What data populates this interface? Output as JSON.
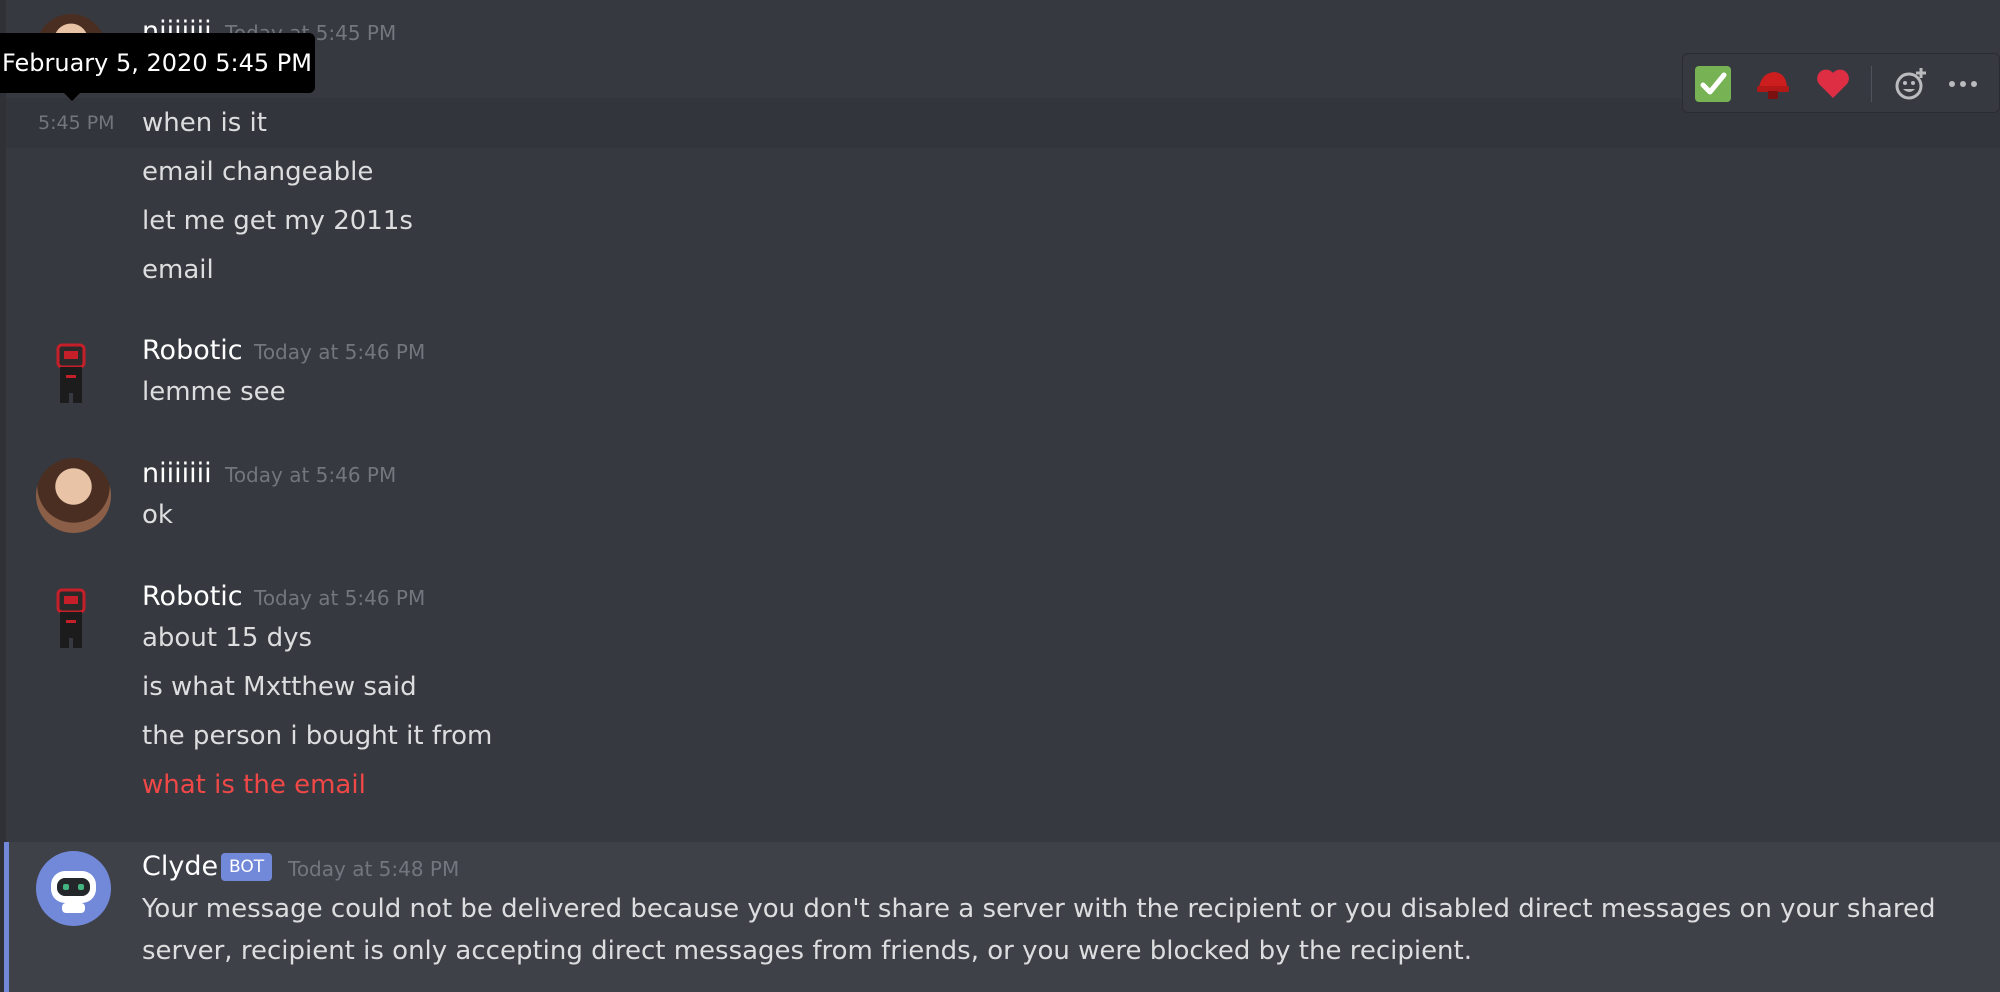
{
  "tooltip": {
    "text": "February 5, 2020 5:45 PM"
  },
  "hover_timestamp": "5:45 PM",
  "message_toolbar": {
    "reactions": [
      "check-mark-emoji",
      "red-hat-emoji",
      "red-heart-emoji"
    ],
    "add_reaction_icon": "add-reaction-icon",
    "more_icon": "more-options-icon"
  },
  "groups": [
    {
      "author": "niiiiiii",
      "timestamp": "Today at 5:45 PM",
      "messages": [
        "when is it",
        "email changeable",
        "let me get my 2011s",
        "email"
      ]
    },
    {
      "author": "Robotic",
      "timestamp": "Today at 5:46 PM",
      "messages": [
        "lemme see"
      ]
    },
    {
      "author": "niiiiiii",
      "timestamp": "Today at 5:46 PM",
      "messages": [
        "ok"
      ]
    },
    {
      "author": "Robotic",
      "timestamp": "Today at 5:46 PM",
      "messages": [
        "about 15 dys",
        "is what Mxtthew said",
        "the person i bought it from",
        "what is the email"
      ]
    },
    {
      "author": "Clyde",
      "badge": "BOT",
      "timestamp": "Today at 5:48 PM",
      "messages": [
        "Your message could not be delivered because you don't share a server with the recipient or you disabled direct messages on your shared server, recipient is only accepting direct messages from friends, or you were blocked by the recipient."
      ]
    }
  ],
  "colors": {
    "background": "#36393f",
    "failed_message": "#f04747",
    "bot_badge": "#7289da",
    "clyde_highlight": "#3f4149"
  }
}
